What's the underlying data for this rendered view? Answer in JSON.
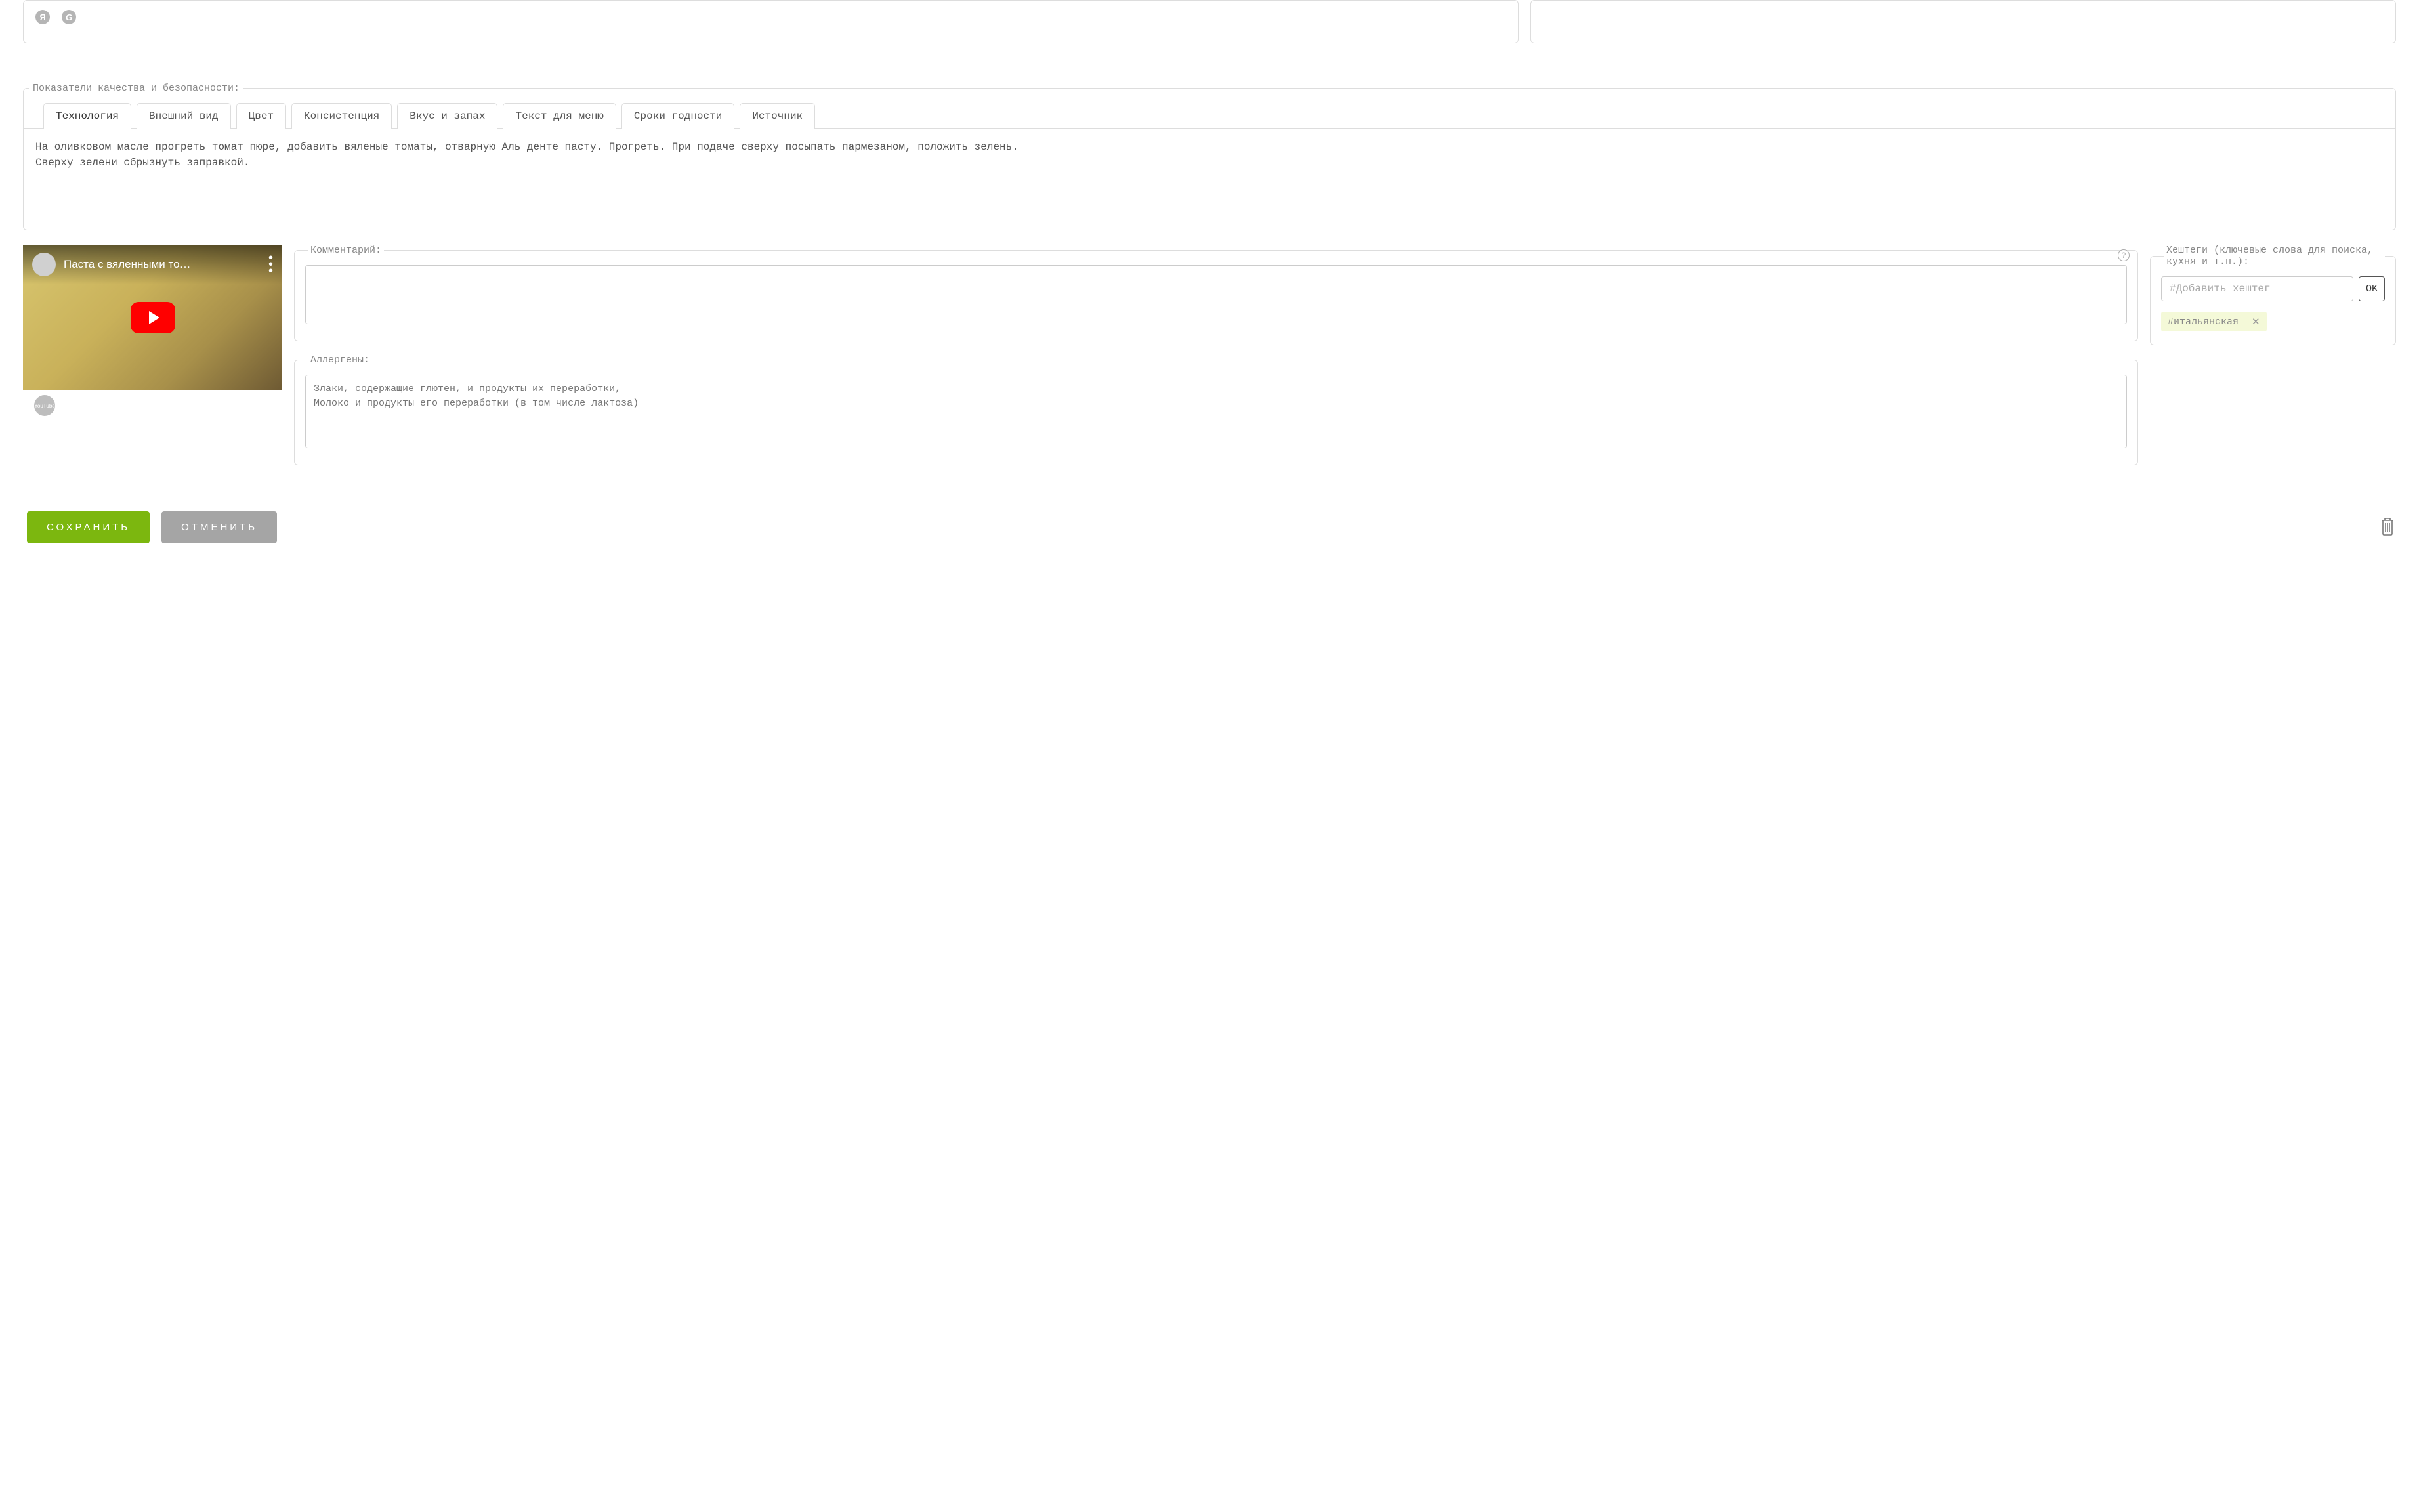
{
  "quality": {
    "legend": "Показатели качества и безопасности:",
    "tabs": [
      "Технология",
      "Внешний вид",
      "Цвет",
      "Консистенция",
      "Вкус и запах",
      "Текст для меню",
      "Сроки годности",
      "Источник"
    ],
    "active_tab": 0,
    "content": "На оливковом масле прогреть томат пюре, добавить вяленые томаты, отварную Аль денте пасту. Прогреть. При подаче сверху посыпать пармезаном, положить зелень.\nСверху зелени сбрызнуть заправкой."
  },
  "video": {
    "title": "Паста с вяленными то…",
    "youtube_badge": "YouTube"
  },
  "comment": {
    "legend": "Комментарий:",
    "value": ""
  },
  "allergens": {
    "legend": "Аллергены:",
    "value": "Злаки, содержащие глютен, и продукты их переработки,\nМолоко и продукты его переработки (в том числе лактоза)"
  },
  "hashtags": {
    "legend": "Хештеги (ключевые слова для поиска, кухня и т.п.):",
    "placeholder": "#Добавить хештег",
    "ok_label": "OK",
    "tags": [
      "#итальянская"
    ]
  },
  "buttons": {
    "save": "СОХРАНИТЬ",
    "cancel": "ОТМЕНИТЬ"
  },
  "icons": {
    "yandex": "Я",
    "google": "G"
  }
}
